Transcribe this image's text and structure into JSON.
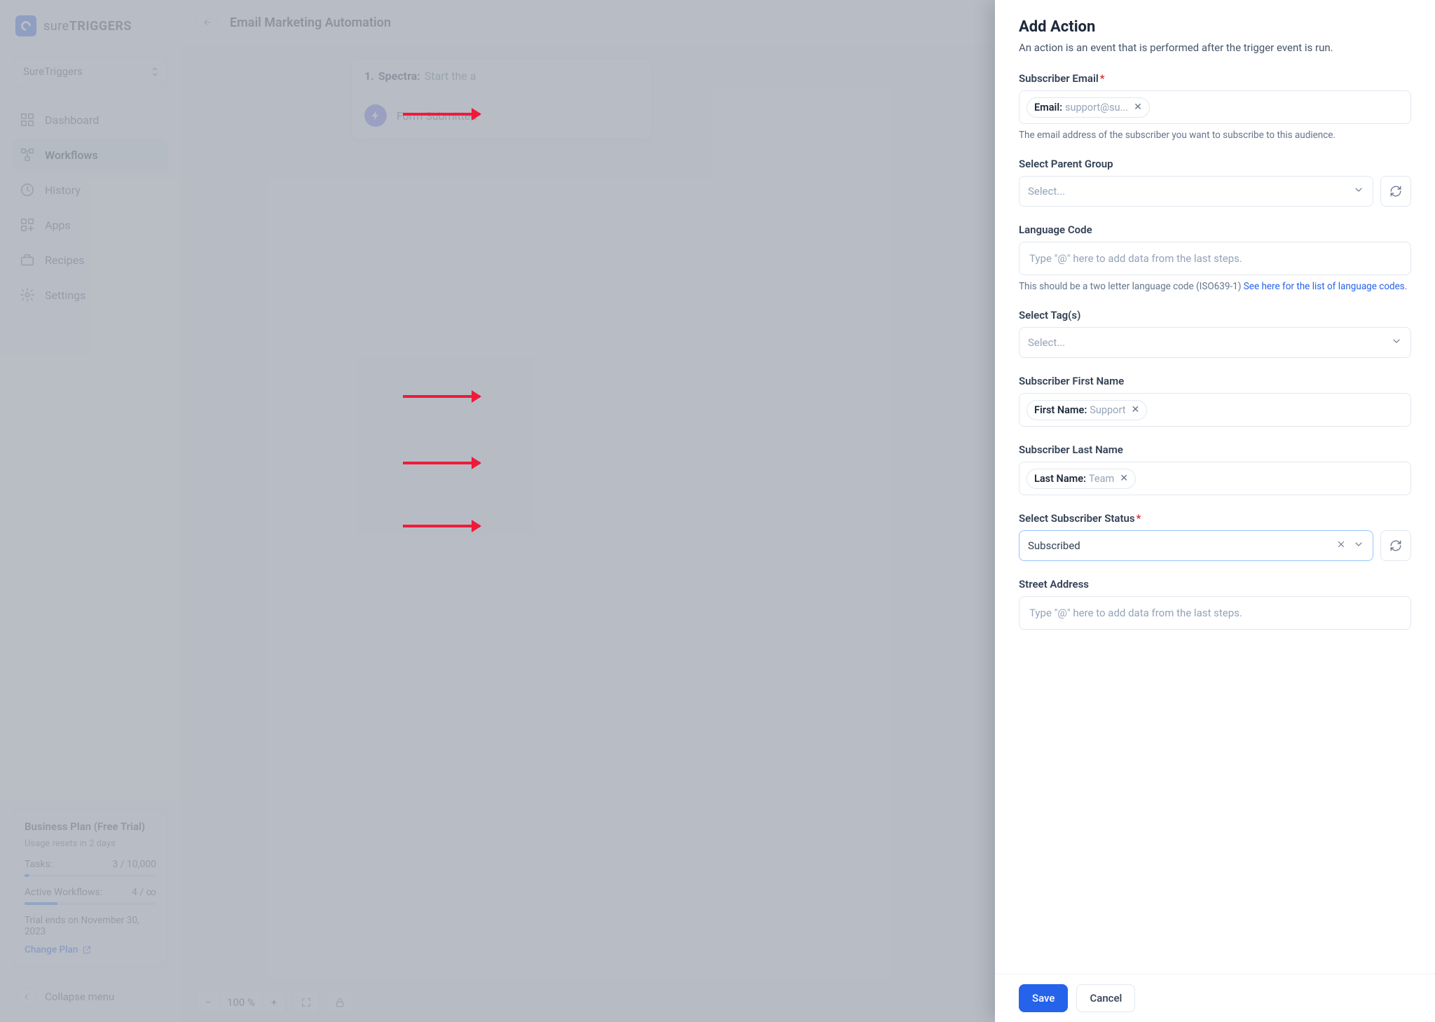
{
  "brand": {
    "thin": "sure",
    "bold": "TRIGGERS"
  },
  "workspace": {
    "name": "SureTriggers"
  },
  "nav": {
    "dashboard": "Dashboard",
    "workflows": "Workflows",
    "history": "History",
    "apps": "Apps",
    "recipes": "Recipes",
    "settings": "Settings"
  },
  "plan": {
    "title": "Business Plan (Free Trial)",
    "reset": "Usage resets in 2 days",
    "tasks_label": "Tasks:",
    "tasks_value": "3 / 10,000",
    "workflows_label": "Active Workflows:",
    "workflows_value": "4 / ∞",
    "trial_end": "Trial ends on November 30, 2023",
    "change_plan": "Change Plan"
  },
  "collapse": "Collapse menu",
  "header": {
    "title": "Email Marketing Automation"
  },
  "flow": {
    "number": "1.",
    "app": "Spectra:",
    "desc": "Start the a",
    "event": "Form Submitted"
  },
  "zoom": {
    "value": "100 %"
  },
  "panel": {
    "title": "Add Action",
    "subtitle": "An action is an event that is performed after the trigger event is run.",
    "fields": {
      "email": {
        "label": "Subscriber Email",
        "pill_key": "Email:",
        "pill_val": "support@su...",
        "helper": "The email address of the subscriber you want to subscribe to this audience."
      },
      "parent_group": {
        "label": "Select Parent Group",
        "placeholder": "Select..."
      },
      "lang": {
        "label": "Language Code",
        "placeholder": "Type \"@\" here to add data from the last steps.",
        "helper_pre": "This should be a two letter language code (ISO639-1) ",
        "helper_link": "See here for the list of language codes."
      },
      "tags": {
        "label": "Select Tag(s)",
        "placeholder": "Select..."
      },
      "first_name": {
        "label": "Subscriber First Name",
        "pill_key": "First Name:",
        "pill_val": "Support"
      },
      "last_name": {
        "label": "Subscriber Last Name",
        "pill_key": "Last Name:",
        "pill_val": "Team"
      },
      "status": {
        "label": "Select Subscriber Status",
        "value": "Subscribed"
      },
      "street": {
        "label": "Street Address",
        "placeholder": "Type \"@\" here to add data from the last steps."
      }
    },
    "buttons": {
      "save": "Save",
      "cancel": "Cancel"
    }
  }
}
